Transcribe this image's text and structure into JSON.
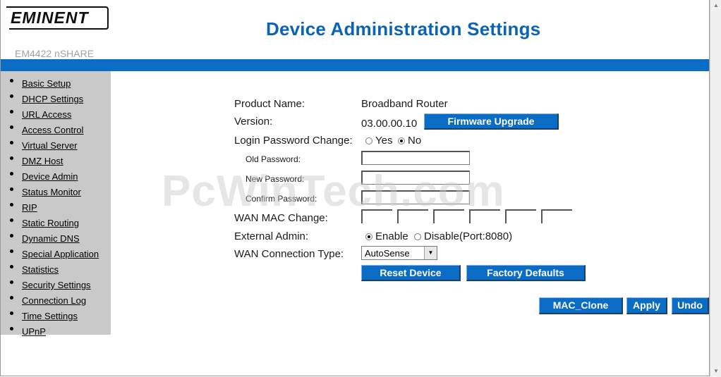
{
  "header": {
    "logo_text": "EMINENT",
    "model": "EM4422 nSHARE",
    "title": "Device Administration Settings"
  },
  "sidebar": {
    "items": [
      {
        "label": "Basic Setup"
      },
      {
        "label": "DHCP Settings"
      },
      {
        "label": "URL Access"
      },
      {
        "label": "Access Control"
      },
      {
        "label": "Virtual Server"
      },
      {
        "label": "DMZ Host"
      },
      {
        "label": "Device Admin"
      },
      {
        "label": "Status Monitor"
      },
      {
        "label": "RIP"
      },
      {
        "label": "Static Routing"
      },
      {
        "label": "Dynamic DNS"
      },
      {
        "label": "Special Application"
      },
      {
        "label": "Statistics"
      },
      {
        "label": "Security Settings"
      },
      {
        "label": "Connection Log"
      },
      {
        "label": "Time Settings"
      },
      {
        "label": "UPnP"
      }
    ]
  },
  "form": {
    "product_name_label": "Product Name:",
    "product_name_value": "Broadband Router",
    "version_label": "Version:",
    "version_value": "03.00.00.10",
    "firmware_button": "Firmware Upgrade",
    "login_pw_label": "Login Password Change:",
    "login_pw_yes": "Yes",
    "login_pw_no": "No",
    "old_password_label": "Old Password:",
    "new_password_label": "New Password:",
    "confirm_password_label": "Confirm Password:",
    "wan_mac_label": "WAN MAC Change:",
    "external_admin_label": "External Admin:",
    "external_admin_enable": "Enable",
    "external_admin_disable": "Disable(Port:8080)",
    "wan_conn_label": "WAN Connection Type:",
    "wan_conn_value": "AutoSense",
    "reset_button": "Reset Device",
    "factory_button": "Factory Defaults"
  },
  "footer_buttons": {
    "mac_clone": "MAC_Clone",
    "apply": "Apply",
    "undo": "Undo"
  },
  "watermark": "PcWinTech.com",
  "colors": {
    "accent": "#0a6cc4",
    "title": "#0a63b3",
    "sidebar_bg": "#c9c9c9"
  }
}
